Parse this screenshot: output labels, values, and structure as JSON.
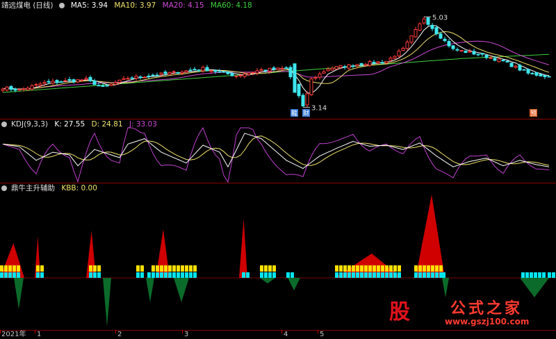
{
  "main": {
    "title": "靖远煤电 (日线)",
    "indicators": [
      {
        "label": "MA5:",
        "value": "3.94",
        "color": "#ffffff"
      },
      {
        "label": "MA10:",
        "value": "3.97",
        "color": "#f2e36b"
      },
      {
        "label": "MA20:",
        "value": "4.15",
        "color": "#d04bd6"
      },
      {
        "label": "MA60:",
        "value": "4.18",
        "color": "#3fd23f"
      }
    ],
    "high_label": "5.03",
    "low_label": "3.14",
    "badges": [
      "龍",
      "财",
      "预"
    ]
  },
  "kdj": {
    "title": "KDJ(9,3,3)",
    "k": "K: 27.55",
    "d": "D: 24.81",
    "j": "J: 33.03"
  },
  "aux": {
    "title": "鼎牛主升辅助",
    "kbb": "KBB: 0.00"
  },
  "xaxis": {
    "labels": [
      "2021年",
      "1",
      "2",
      "3",
      "4",
      "5"
    ]
  },
  "watermark": {
    "logo": "股",
    "name": "公式之家",
    "url": "www.gszj100.com"
  },
  "colors": {
    "up": "#ff3b3b",
    "down": "#3ee7ee",
    "ma5": "#ffffff",
    "ma10": "#f2e36b",
    "ma20": "#d04bd6",
    "ma60": "#3fd23f",
    "kline": "#ffffff",
    "dline": "#f2e36b",
    "jline": "#c040d0",
    "bar_yellow": "#ffe000",
    "bar_cyan": "#00e5ee",
    "red_fill": "#d00000",
    "green_fill": "#0b6b2a"
  },
  "chart_data": [
    {
      "type": "candlestick",
      "price_range": [
        3.0,
        5.15
      ],
      "series": [
        {
          "name": "MA5",
          "value": "3.94"
        },
        {
          "name": "MA10",
          "value": "3.97"
        },
        {
          "name": "MA20",
          "value": "4.15"
        },
        {
          "name": "MA60",
          "value": "4.18"
        }
      ],
      "annotations": [
        {
          "label": "5.03",
          "value": 5.03
        },
        {
          "label": "3.14",
          "value": 3.14
        }
      ]
    },
    {
      "type": "line",
      "title": "KDJ(9,3,3)",
      "series": [
        {
          "name": "K",
          "value": 27.55
        },
        {
          "name": "D",
          "value": 24.81
        },
        {
          "name": "J",
          "value": 33.03
        }
      ]
    },
    {
      "type": "area",
      "title": "鼎牛主升辅助",
      "series": [
        {
          "name": "KBB",
          "value": 0.0
        }
      ]
    }
  ]
}
